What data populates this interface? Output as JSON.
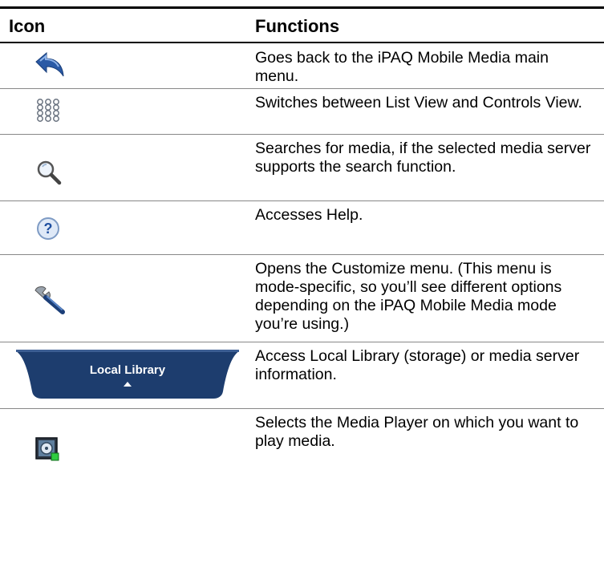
{
  "table": {
    "header": {
      "icon": "Icon",
      "functions": "Functions"
    },
    "rows": [
      {
        "icon": "back-arrow-icon",
        "text": "Goes back to the iPAQ Mobile Media main menu."
      },
      {
        "icon": "grid-view-icon",
        "text": "Switches between List View and Controls View."
      },
      {
        "icon": "magnifier-icon",
        "text": "Searches for media, if the selected media server supports the search function."
      },
      {
        "icon": "help-icon",
        "text": "Accesses Help."
      },
      {
        "icon": "wrench-icon",
        "text": "Opens the Customize menu. (This menu is mode-specific, so you’ll see different options depending on the iPAQ Mobile Media mode you’re using.)"
      },
      {
        "icon": "local-library-tab",
        "label": "Local Library",
        "text": "Access Local Library (storage) or media server information."
      },
      {
        "icon": "media-player-icon",
        "text": "Selects the Media Player on which you want to play media."
      }
    ]
  },
  "colors": {
    "tab_blue": "#1d3d6e",
    "icon_blue": "#2a5aa6",
    "rule": "#000000",
    "row_rule": "#888888"
  }
}
